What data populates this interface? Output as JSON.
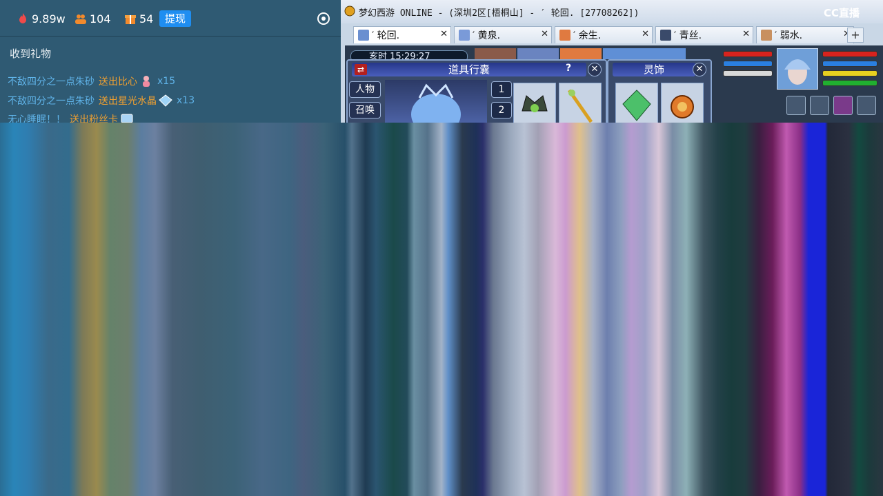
{
  "stats": {
    "popularity": "9.89w",
    "fans": "104",
    "gifts": "54",
    "withdraw_label": "提现"
  },
  "gift_panel": {
    "title": "收到礼物",
    "rows": [
      {
        "user": "不敌四分之一点朱砂",
        "action": "送出比心",
        "count": "x15"
      },
      {
        "user": "不敌四分之一点朱砂",
        "action": "送出星光水晶",
        "count": "x13"
      },
      {
        "user": "无心睡眠！！",
        "action": "送出粉丝卡",
        "count": ""
      }
    ]
  },
  "game_window": {
    "title": "梦幻西游 ONLINE - (深圳2区[梧桐山] - ′ 轮回. [27708262])",
    "logo": "CC直播",
    "tabs": [
      {
        "label": "′ 轮回.",
        "active": true
      },
      {
        "label": "′ 黄泉.",
        "active": false
      },
      {
        "label": "′ 余生.",
        "active": false
      },
      {
        "label": "′ 青丝.",
        "active": false
      },
      {
        "label": "′ 弱水.",
        "active": false
      }
    ],
    "tab_add": "+",
    "clock": "亥时 15:29:27",
    "bag": {
      "title": "道具行囊",
      "help": "?",
      "close": "✕",
      "btn_person": "人物",
      "btn_summon": "召唤",
      "page_1": "1",
      "page_2": "2"
    },
    "ling": {
      "title": "灵饰",
      "close": "✕"
    }
  }
}
